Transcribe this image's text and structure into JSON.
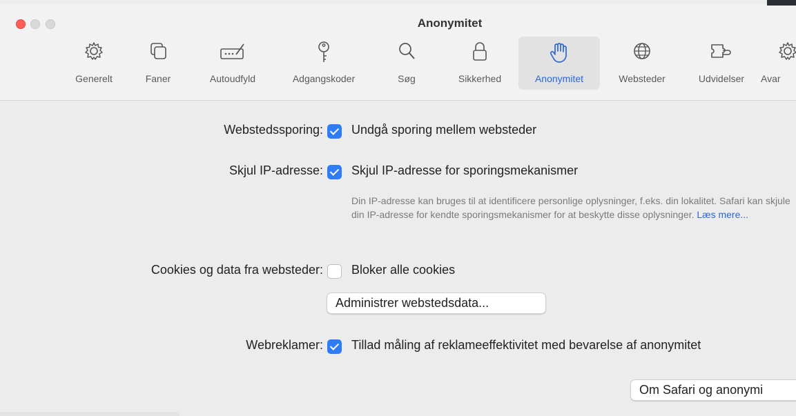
{
  "window": {
    "title": "Anonymitet"
  },
  "tabs": [
    {
      "label": "Generelt",
      "icon": "gear-icon"
    },
    {
      "label": "Faner",
      "icon": "tabs-icon"
    },
    {
      "label": "Autoudfyld",
      "icon": "autofill-pencil-icon"
    },
    {
      "label": "Adgangskoder",
      "icon": "key-icon"
    },
    {
      "label": "Søg",
      "icon": "search-icon"
    },
    {
      "label": "Sikkerhed",
      "icon": "lock-icon"
    },
    {
      "label": "Anonymitet",
      "icon": "hand-icon",
      "active": true
    },
    {
      "label": "Websteder",
      "icon": "globe-icon"
    },
    {
      "label": "Udvidelser",
      "icon": "puzzle-icon"
    },
    {
      "label": "Avar",
      "icon": "gear-advanced-icon"
    }
  ],
  "settings": {
    "tracking": {
      "label": "Webstedssporing:",
      "option": "Undgå sporing mellem websteder",
      "checked": true
    },
    "hide_ip": {
      "label": "Skjul IP-adresse:",
      "option": "Skjul IP-adresse for sporingsmekanismer",
      "checked": true,
      "description": "Din IP-adresse kan bruges til at identificere personlige oplysninger, f.eks. din lokalitet. Safari kan skjule din IP-adresse for kendte sporingsmekanismer for at beskytte disse oplysninger.",
      "learn_more": "Læs mere..."
    },
    "cookies": {
      "label": "Cookies og data fra websteder:",
      "option": "Bloker alle cookies",
      "checked": false,
      "manage_button": "Administrer webstedsdata..."
    },
    "ads": {
      "label": "Webreklamer:",
      "option": "Tillad måling af reklameeffektivitet med bevarelse af anonymitet",
      "checked": true
    }
  },
  "footer": {
    "about_button": "Om Safari og anonymi"
  },
  "colors": {
    "accent": "#2f7cf6",
    "active_tab": "#2a66d6",
    "close": "#ff5f57"
  }
}
